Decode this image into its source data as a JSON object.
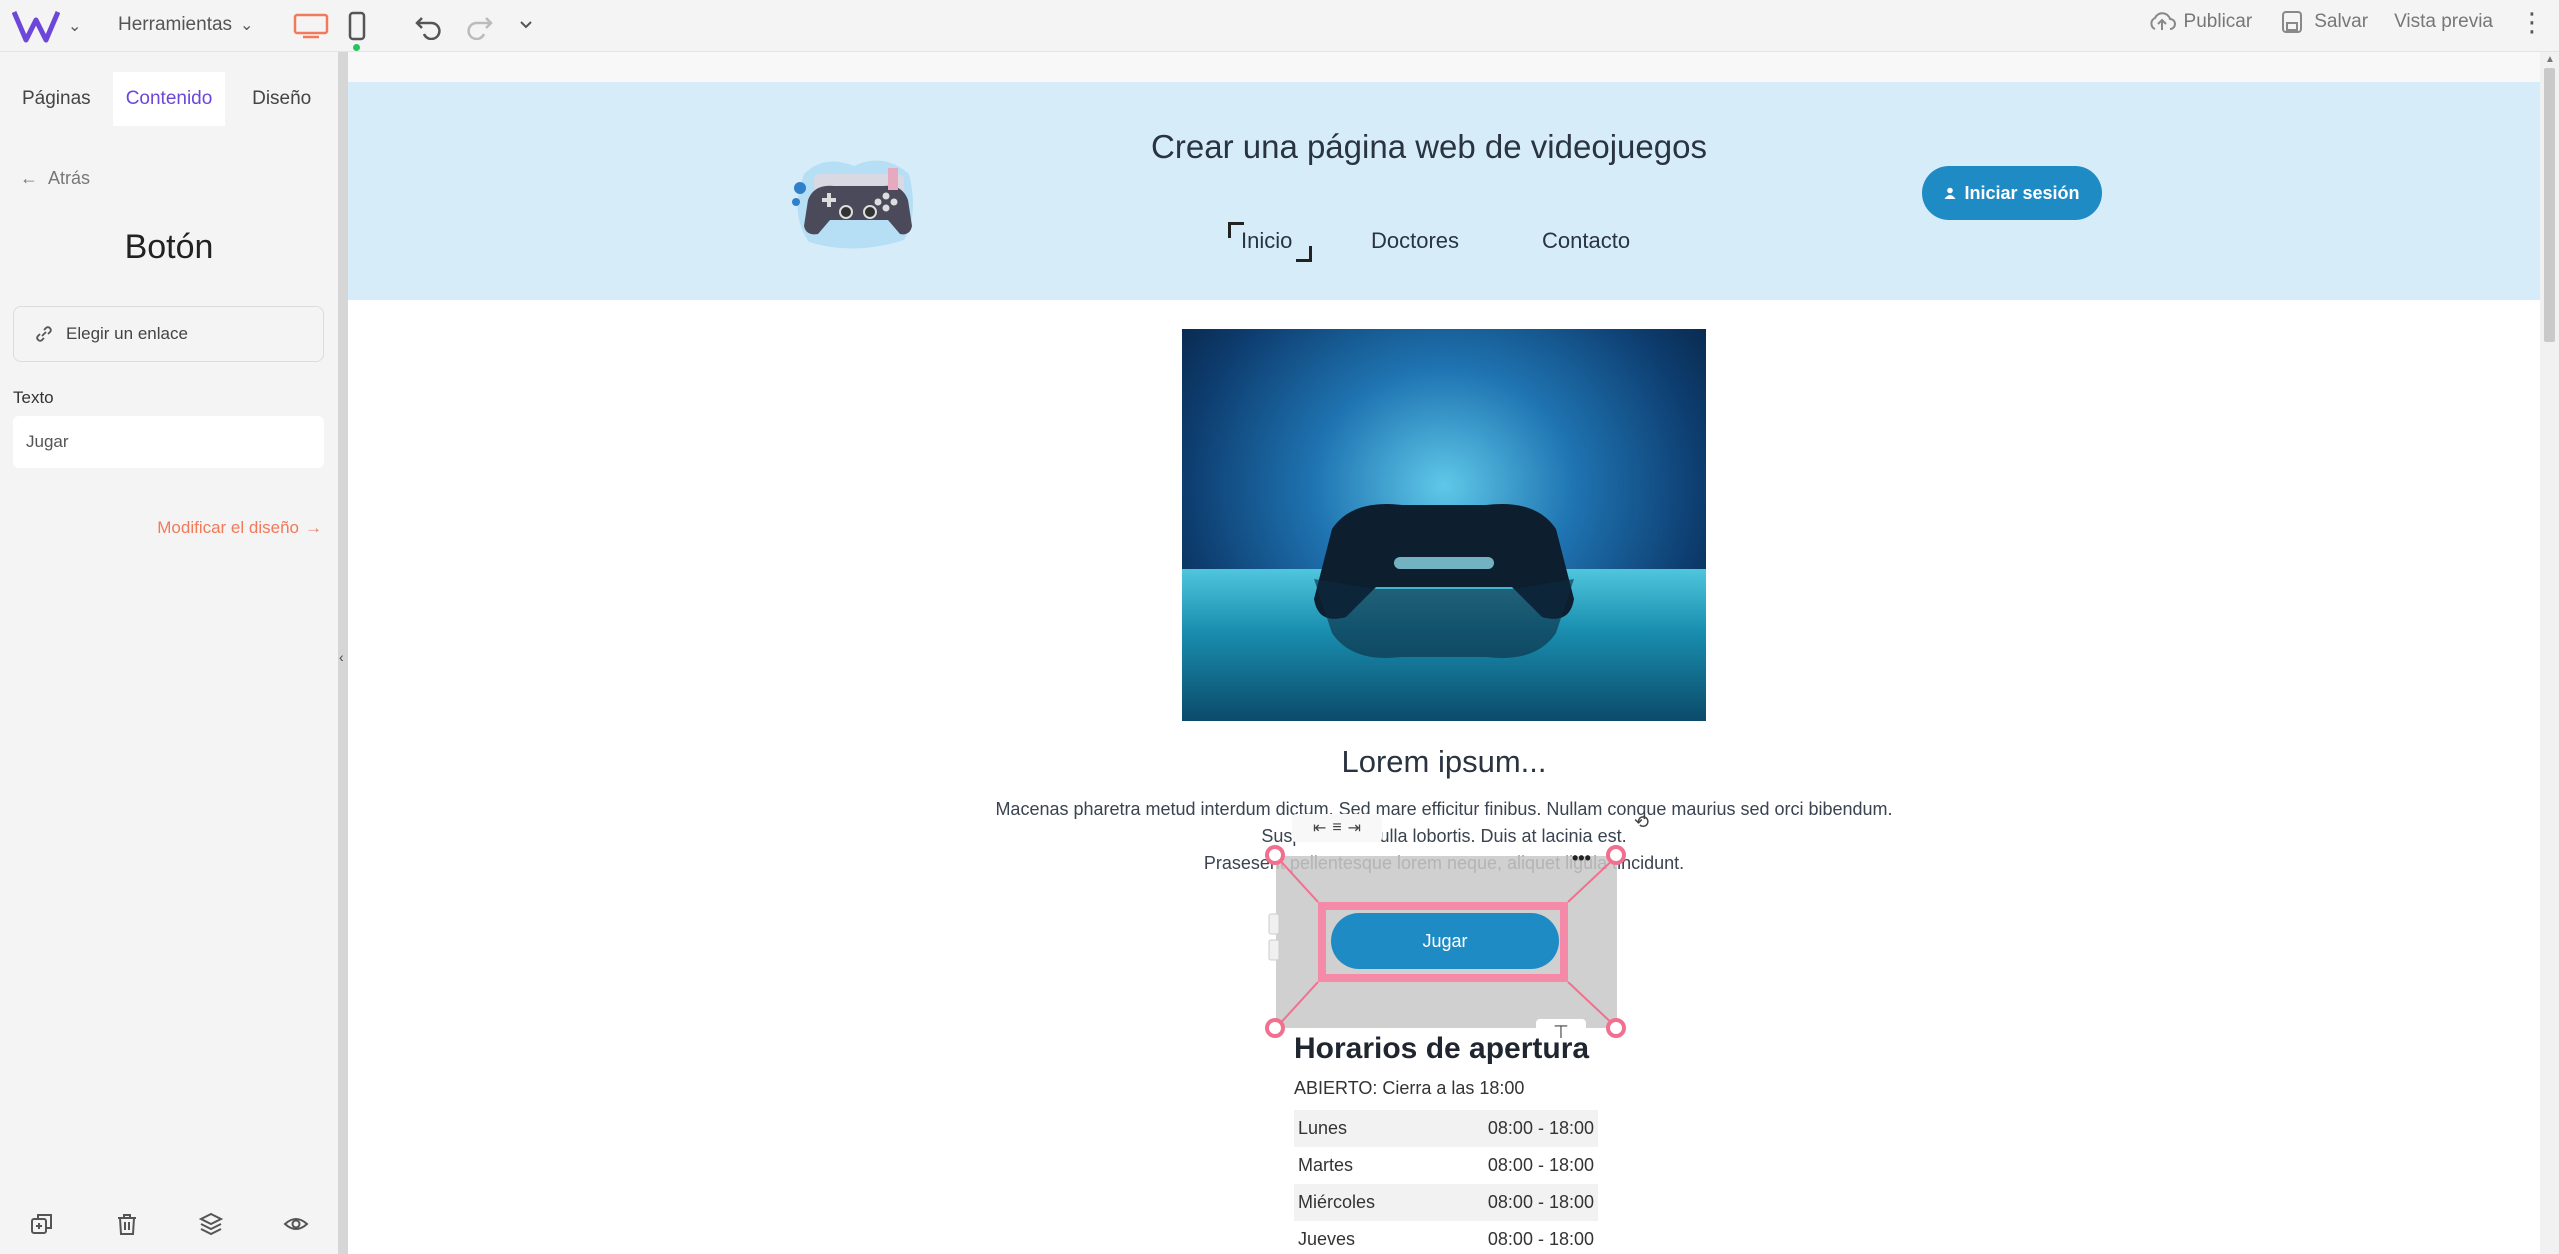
{
  "topbar": {
    "tools_label": "Herramientas",
    "publish_label": "Publicar",
    "save_label": "Salvar",
    "preview_label": "Vista previa",
    "brand_color": "#6c47d9",
    "accent_color": "#f07a5a"
  },
  "leftpanel": {
    "tabs": [
      {
        "label": "Páginas"
      },
      {
        "label": "Contenido"
      },
      {
        "label": "Diseño"
      }
    ],
    "back_label": "Atrás",
    "title": "Botón",
    "link_label": "Elegir un enlace",
    "text_field_label": "Texto",
    "text_field_value": "Jugar",
    "modify_label": "Modificar el diseño"
  },
  "site": {
    "title": "Crear una página web de videojuegos",
    "nav": [
      "Inicio",
      "Doctores",
      "Contacto"
    ],
    "login_label": "Iniciar sesión",
    "section_title": "Lorem ipsum...",
    "section_text": [
      "Macenas pharetra metud interdum dictum. Sed mare efficitur finibus. Nullam conque maurius sed orci bibendum.",
      "Suspendisse nulla lobortis. Duis at lacinia est.",
      "Prasesent pellentesque lorem neque, aliquet ligula tincidunt."
    ],
    "button_label": "Jugar",
    "hours_title": "Horarios de apertura",
    "hours_status": "ABIERTO: Cierra a las 18:00",
    "hours": [
      {
        "day": "Lunes",
        "time": "08:00 - 18:00"
      },
      {
        "day": "Martes",
        "time": "08:00 - 18:00"
      },
      {
        "day": "Miércoles",
        "time": "08:00 - 18:00"
      },
      {
        "day": "Jueves",
        "time": "08:00 - 18:00"
      }
    ],
    "header_color": "#d6edf9",
    "button_color": "#1f8bc4",
    "selection_color": "#f58aa8"
  }
}
